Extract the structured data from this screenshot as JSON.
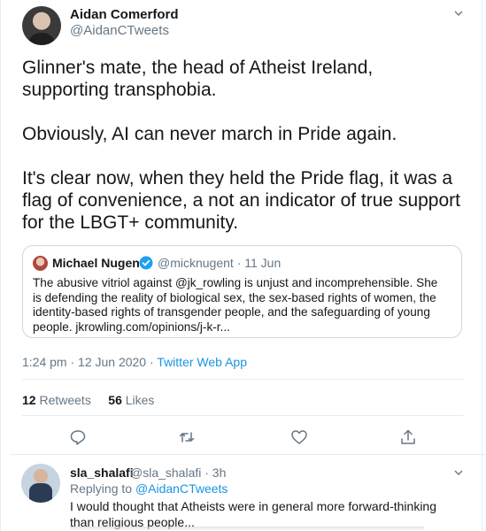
{
  "tweet": {
    "author_name": "Aidan Comerford",
    "author_handle": "@AidanCTweets",
    "text": "Glinner's mate, the head of Atheist Ireland, supporting transphobia.\n\nObviously, AI can never march in Pride again.\n\nIt's clear now, when they held the Pride flag, it was a flag of convenience, a not an indicator of true support for the LBGT+ community.",
    "time": "1:24 pm · 12 Jun 2020 · ",
    "source": "Twitter Web App",
    "retweets_count": "12",
    "retweets_label": " Retweets",
    "likes_count": "56",
    "likes_label": " Likes"
  },
  "quote": {
    "author_name": "Michael Nugent",
    "author_handle": "@micknugent · 11 Jun",
    "text": "The abusive vitriol against @jk_rowling is unjust and incomprehensible. She is defending the reality of biological sex, the sex-based rights of women, the identity-based rights of transgender people, and the safeguarding of young people. jkrowling.com/opinions/j-k-r..."
  },
  "reply": {
    "author_name": "sla_shalafi",
    "author_handle": "@sla_shalafi · 3h",
    "replying_prefix": "Replying to ",
    "replying_to": "@AidanCTweets",
    "text": "I would thought that Atheists were in general more forward-thinking than religious people..."
  },
  "icons": {
    "more": "chevron-down-icon",
    "verified": "verified-badge-icon",
    "reply": "reply-icon",
    "retweet": "retweet-icon",
    "like": "like-icon",
    "share": "share-icon"
  },
  "colors": {
    "accent": "#1b95e0",
    "verified": "#1da1f2",
    "muted": "#657786",
    "text": "#14171a",
    "border": "#e6ecf0"
  }
}
